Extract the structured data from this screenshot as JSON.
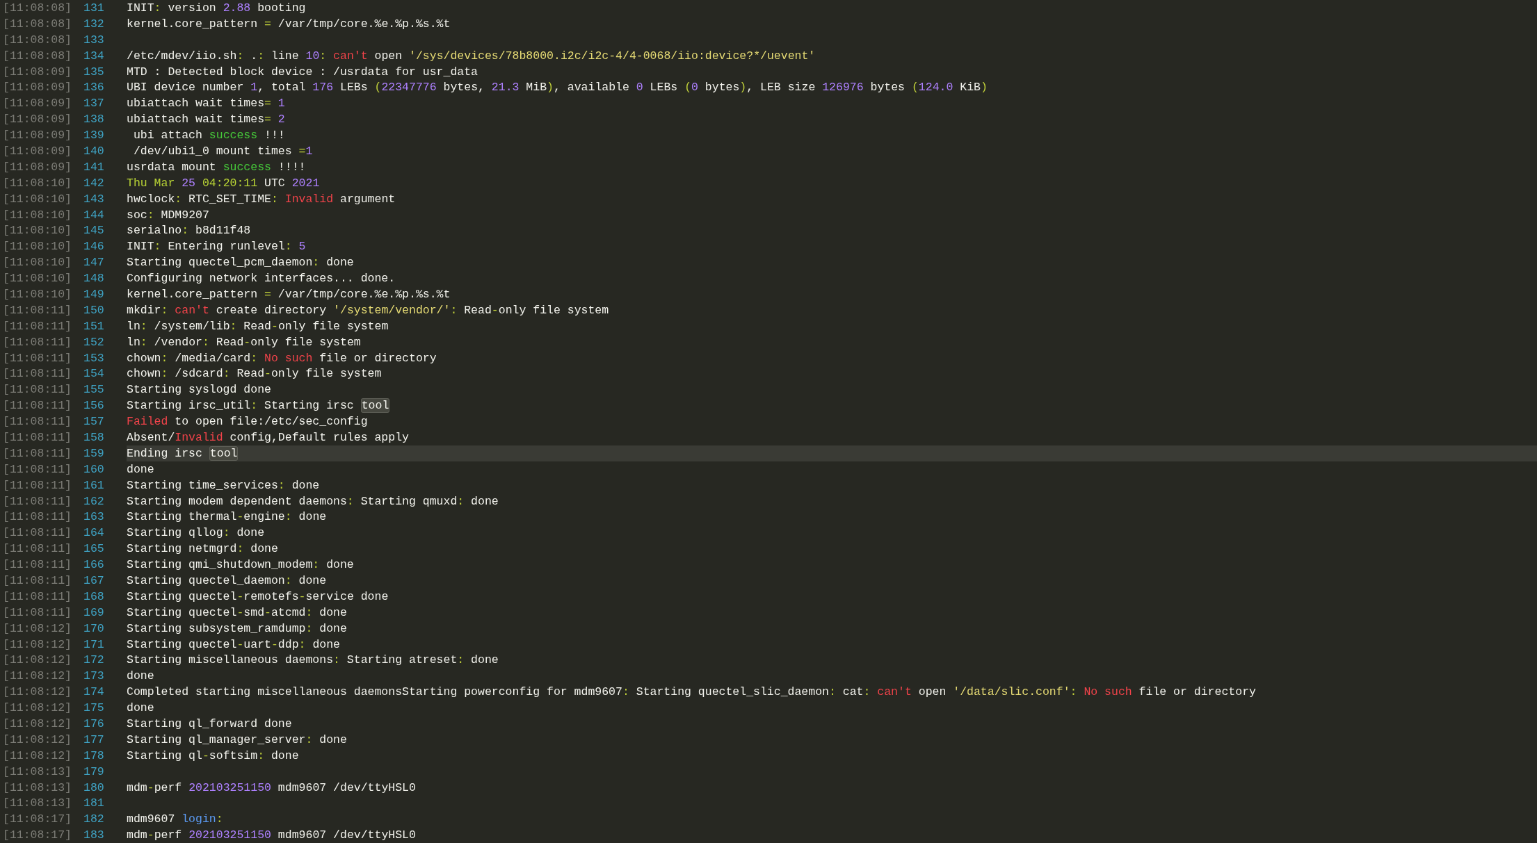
{
  "lines": [
    {
      "time": "[11:08:08]",
      "number": "131",
      "current": false,
      "segments": [
        {
          "text": "INIT",
          "kind": "text"
        },
        {
          "text": ":",
          "kind": "punct"
        },
        {
          "text": " version ",
          "kind": "text"
        },
        {
          "text": "2.88",
          "kind": "number"
        },
        {
          "text": " booting",
          "kind": "text"
        }
      ]
    },
    {
      "time": "[11:08:08]",
      "number": "132",
      "current": false,
      "segments": [
        {
          "text": "kernel.core_pattern ",
          "kind": "text"
        },
        {
          "text": "=",
          "kind": "punct"
        },
        {
          "text": " /var/tmp/core.%e.%p.%s.%t",
          "kind": "text"
        }
      ]
    },
    {
      "time": "[11:08:08]",
      "number": "133",
      "current": false
    },
    {
      "time": "[11:08:08]",
      "number": "134",
      "current": false,
      "segments": [
        {
          "text": "/etc/mdev/iio.sh",
          "kind": "text"
        },
        {
          "text": ":",
          "kind": "punct"
        },
        {
          "text": " .",
          "kind": "text"
        },
        {
          "text": ":",
          "kind": "punct"
        },
        {
          "text": " line ",
          "kind": "text"
        },
        {
          "text": "10",
          "kind": "number"
        },
        {
          "text": ": ",
          "kind": "punct"
        },
        {
          "text": "can't",
          "kind": "error"
        },
        {
          "text": " open ",
          "kind": "text"
        },
        {
          "text": "'/sys/devices/78b8000.i2c/i2c-4/4-0068/iio:device?*/uevent'",
          "kind": "string"
        }
      ]
    },
    {
      "time": "[11:08:09]",
      "number": "135",
      "current": false,
      "segments": [
        {
          "text": "MTD : Detected block device : /usrdata for usr_data",
          "kind": "text"
        }
      ]
    },
    {
      "time": "[11:08:09]",
      "number": "136",
      "current": false,
      "segments": [
        {
          "text": "UBI device number ",
          "kind": "text"
        },
        {
          "text": "1",
          "kind": "number"
        },
        {
          "text": ", total ",
          "kind": "text"
        },
        {
          "text": "176",
          "kind": "number"
        },
        {
          "text": " LEBs ",
          "kind": "text"
        },
        {
          "text": "(",
          "kind": "punct"
        },
        {
          "text": "22347776",
          "kind": "number"
        },
        {
          "text": " bytes, ",
          "kind": "text"
        },
        {
          "text": "21.3",
          "kind": "number"
        },
        {
          "text": " MiB",
          "kind": "text"
        },
        {
          "text": ")",
          "kind": "punct"
        },
        {
          "text": ", available ",
          "kind": "text"
        },
        {
          "text": "0",
          "kind": "number"
        },
        {
          "text": " LEBs ",
          "kind": "text"
        },
        {
          "text": "(",
          "kind": "punct"
        },
        {
          "text": "0",
          "kind": "number"
        },
        {
          "text": " bytes",
          "kind": "text"
        },
        {
          "text": ")",
          "kind": "punct"
        },
        {
          "text": ", LEB size ",
          "kind": "text"
        },
        {
          "text": "126976",
          "kind": "number"
        },
        {
          "text": " bytes ",
          "kind": "text"
        },
        {
          "text": "(",
          "kind": "punct"
        },
        {
          "text": "124.0",
          "kind": "number"
        },
        {
          "text": " KiB",
          "kind": "text"
        },
        {
          "text": ")",
          "kind": "punct"
        }
      ]
    },
    {
      "time": "[11:08:09]",
      "number": "137",
      "current": false,
      "segments": [
        {
          "text": "ubiattach wait times",
          "kind": "text"
        },
        {
          "text": "= ",
          "kind": "punct"
        },
        {
          "text": "1",
          "kind": "number"
        }
      ]
    },
    {
      "time": "[11:08:09]",
      "number": "138",
      "current": false,
      "segments": [
        {
          "text": "ubiattach wait times",
          "kind": "text"
        },
        {
          "text": "= ",
          "kind": "punct"
        },
        {
          "text": "2",
          "kind": "number"
        }
      ]
    },
    {
      "time": "[11:08:09]",
      "number": "139",
      "current": false,
      "segments": [
        {
          "text": " ubi attach ",
          "kind": "text"
        },
        {
          "text": "success",
          "kind": "success"
        },
        {
          "text": " !!!",
          "kind": "text"
        }
      ]
    },
    {
      "time": "[11:08:09]",
      "number": "140",
      "current": false,
      "segments": [
        {
          "text": " /dev/ubi1_0 mount times ",
          "kind": "text"
        },
        {
          "text": "=",
          "kind": "punct"
        },
        {
          "text": "1",
          "kind": "number"
        }
      ]
    },
    {
      "time": "[11:08:09]",
      "number": "141",
      "current": false,
      "segments": [
        {
          "text": "usrdata mount ",
          "kind": "text"
        },
        {
          "text": "success",
          "kind": "success"
        },
        {
          "text": " !!!!",
          "kind": "text"
        }
      ]
    },
    {
      "time": "[11:08:10]",
      "number": "142",
      "current": false,
      "segments": [
        {
          "text": "Thu Mar ",
          "kind": "date"
        },
        {
          "text": "25",
          "kind": "number"
        },
        {
          "text": " 04:20:11",
          "kind": "date"
        },
        {
          "text": " UTC ",
          "kind": "text"
        },
        {
          "text": "2021",
          "kind": "number"
        }
      ]
    },
    {
      "time": "[11:08:10]",
      "number": "143",
      "current": false,
      "segments": [
        {
          "text": "hwclock",
          "kind": "text"
        },
        {
          "text": ":",
          "kind": "punct"
        },
        {
          "text": " RTC_SET_TIME",
          "kind": "text"
        },
        {
          "text": ": ",
          "kind": "punct"
        },
        {
          "text": "Invalid",
          "kind": "error"
        },
        {
          "text": " argument",
          "kind": "text"
        }
      ]
    },
    {
      "time": "[11:08:10]",
      "number": "144",
      "current": false,
      "segments": [
        {
          "text": "soc",
          "kind": "text"
        },
        {
          "text": ":",
          "kind": "punct"
        },
        {
          "text": " MDM9207",
          "kind": "text"
        }
      ]
    },
    {
      "time": "[11:08:10]",
      "number": "145",
      "current": false,
      "segments": [
        {
          "text": "serialno",
          "kind": "text"
        },
        {
          "text": ":",
          "kind": "punct"
        },
        {
          "text": " b8d11f48",
          "kind": "text"
        }
      ]
    },
    {
      "time": "[11:08:10]",
      "number": "146",
      "current": false,
      "segments": [
        {
          "text": "INIT",
          "kind": "text"
        },
        {
          "text": ":",
          "kind": "punct"
        },
        {
          "text": " Entering runlevel",
          "kind": "text"
        },
        {
          "text": ": ",
          "kind": "punct"
        },
        {
          "text": "5",
          "kind": "number"
        }
      ]
    },
    {
      "time": "[11:08:10]",
      "number": "147",
      "current": false,
      "segments": [
        {
          "text": "Starting quectel_pcm_daemon",
          "kind": "text"
        },
        {
          "text": ":",
          "kind": "punct"
        },
        {
          "text": " done",
          "kind": "text"
        }
      ]
    },
    {
      "time": "[11:08:10]",
      "number": "148",
      "current": false,
      "segments": [
        {
          "text": "Configuring network interfaces... done.",
          "kind": "text"
        }
      ]
    },
    {
      "time": "[11:08:10]",
      "number": "149",
      "current": false,
      "segments": [
        {
          "text": "kernel.core_pattern ",
          "kind": "text"
        },
        {
          "text": "=",
          "kind": "punct"
        },
        {
          "text": " /var/tmp/core.%e.%p.%s.%t",
          "kind": "text"
        }
      ]
    },
    {
      "time": "[11:08:11]",
      "number": "150",
      "current": false,
      "segments": [
        {
          "text": "mkdir",
          "kind": "text"
        },
        {
          "text": ": ",
          "kind": "punct"
        },
        {
          "text": "can't",
          "kind": "error"
        },
        {
          "text": " create directory ",
          "kind": "text"
        },
        {
          "text": "'/system/vendor/'",
          "kind": "string"
        },
        {
          "text": ":",
          "kind": "punct"
        },
        {
          "text": " Read",
          "kind": "text"
        },
        {
          "text": "-",
          "kind": "punct"
        },
        {
          "text": "only file system",
          "kind": "text"
        }
      ]
    },
    {
      "time": "[11:08:11]",
      "number": "151",
      "current": false,
      "segments": [
        {
          "text": "ln",
          "kind": "text"
        },
        {
          "text": ":",
          "kind": "punct"
        },
        {
          "text": " /system/lib",
          "kind": "text"
        },
        {
          "text": ":",
          "kind": "punct"
        },
        {
          "text": " Read",
          "kind": "text"
        },
        {
          "text": "-",
          "kind": "punct"
        },
        {
          "text": "only file system",
          "kind": "text"
        }
      ]
    },
    {
      "time": "[11:08:11]",
      "number": "152",
      "current": false,
      "segments": [
        {
          "text": "ln",
          "kind": "text"
        },
        {
          "text": ":",
          "kind": "punct"
        },
        {
          "text": " /vendor",
          "kind": "text"
        },
        {
          "text": ":",
          "kind": "punct"
        },
        {
          "text": " Read",
          "kind": "text"
        },
        {
          "text": "-",
          "kind": "punct"
        },
        {
          "text": "only file system",
          "kind": "text"
        }
      ]
    },
    {
      "time": "[11:08:11]",
      "number": "153",
      "current": false,
      "segments": [
        {
          "text": "chown",
          "kind": "text"
        },
        {
          "text": ":",
          "kind": "punct"
        },
        {
          "text": " /media/card",
          "kind": "text"
        },
        {
          "text": ": ",
          "kind": "punct"
        },
        {
          "text": "No such",
          "kind": "error"
        },
        {
          "text": " file or directory",
          "kind": "text"
        }
      ]
    },
    {
      "time": "[11:08:11]",
      "number": "154",
      "current": false,
      "segments": [
        {
          "text": "chown",
          "kind": "text"
        },
        {
          "text": ":",
          "kind": "punct"
        },
        {
          "text": " /sdcard",
          "kind": "text"
        },
        {
          "text": ":",
          "kind": "punct"
        },
        {
          "text": " Read",
          "kind": "text"
        },
        {
          "text": "-",
          "kind": "punct"
        },
        {
          "text": "only file system",
          "kind": "text"
        }
      ]
    },
    {
      "time": "[11:08:11]",
      "number": "155",
      "current": false,
      "segments": [
        {
          "text": "Starting syslogd done",
          "kind": "text"
        }
      ]
    },
    {
      "time": "[11:08:11]",
      "number": "156",
      "current": false,
      "segments": [
        {
          "text": "Starting irsc_util",
          "kind": "text"
        },
        {
          "text": ":",
          "kind": "punct"
        },
        {
          "text": " Starting irsc ",
          "kind": "text"
        },
        {
          "text": "tool",
          "kind": "match"
        }
      ]
    },
    {
      "time": "[11:08:11]",
      "number": "157",
      "current": false,
      "segments": [
        {
          "text": "Failed",
          "kind": "error"
        },
        {
          "text": " to open file:/etc/sec_config",
          "kind": "text"
        }
      ]
    },
    {
      "time": "[11:08:11]",
      "number": "158",
      "current": false,
      "segments": [
        {
          "text": "Absent/",
          "kind": "text"
        },
        {
          "text": "Invalid",
          "kind": "error"
        },
        {
          "text": " config,Default rules apply",
          "kind": "text"
        }
      ]
    },
    {
      "time": "[11:08:11]",
      "number": "159",
      "current": true,
      "segments": [
        {
          "text": "Ending irsc ",
          "kind": "text"
        },
        {
          "text": "tool",
          "kind": "match"
        }
      ]
    },
    {
      "time": "[11:08:11]",
      "number": "160",
      "current": false,
      "segments": [
        {
          "text": "done",
          "kind": "text"
        }
      ]
    },
    {
      "time": "[11:08:11]",
      "number": "161",
      "current": false,
      "segments": [
        {
          "text": "Starting time_services",
          "kind": "text"
        },
        {
          "text": ":",
          "kind": "punct"
        },
        {
          "text": " done",
          "kind": "text"
        }
      ]
    },
    {
      "time": "[11:08:11]",
      "number": "162",
      "current": false,
      "segments": [
        {
          "text": "Starting modem dependent daemons",
          "kind": "text"
        },
        {
          "text": ":",
          "kind": "punct"
        },
        {
          "text": " Starting qmuxd",
          "kind": "text"
        },
        {
          "text": ":",
          "kind": "punct"
        },
        {
          "text": " done",
          "kind": "text"
        }
      ]
    },
    {
      "time": "[11:08:11]",
      "number": "163",
      "current": false,
      "segments": [
        {
          "text": "Starting thermal",
          "kind": "text"
        },
        {
          "text": "-",
          "kind": "punct"
        },
        {
          "text": "engine",
          "kind": "text"
        },
        {
          "text": ":",
          "kind": "punct"
        },
        {
          "text": " done",
          "kind": "text"
        }
      ]
    },
    {
      "time": "[11:08:11]",
      "number": "164",
      "current": false,
      "segments": [
        {
          "text": "Starting qllog",
          "kind": "text"
        },
        {
          "text": ":",
          "kind": "punct"
        },
        {
          "text": " done",
          "kind": "text"
        }
      ]
    },
    {
      "time": "[11:08:11]",
      "number": "165",
      "current": false,
      "segments": [
        {
          "text": "Starting netmgrd",
          "kind": "text"
        },
        {
          "text": ":",
          "kind": "punct"
        },
        {
          "text": " done",
          "kind": "text"
        }
      ]
    },
    {
      "time": "[11:08:11]",
      "number": "166",
      "current": false,
      "segments": [
        {
          "text": "Starting qmi_shutdown_modem",
          "kind": "text"
        },
        {
          "text": ":",
          "kind": "punct"
        },
        {
          "text": " done",
          "kind": "text"
        }
      ]
    },
    {
      "time": "[11:08:11]",
      "number": "167",
      "current": false,
      "segments": [
        {
          "text": "Starting quectel_daemon",
          "kind": "text"
        },
        {
          "text": ":",
          "kind": "punct"
        },
        {
          "text": " done",
          "kind": "text"
        }
      ]
    },
    {
      "time": "[11:08:11]",
      "number": "168",
      "current": false,
      "segments": [
        {
          "text": "Starting quectel",
          "kind": "text"
        },
        {
          "text": "-",
          "kind": "punct"
        },
        {
          "text": "remotefs",
          "kind": "text"
        },
        {
          "text": "-",
          "kind": "punct"
        },
        {
          "text": "service done",
          "kind": "text"
        }
      ]
    },
    {
      "time": "[11:08:11]",
      "number": "169",
      "current": false,
      "segments": [
        {
          "text": "Starting quectel",
          "kind": "text"
        },
        {
          "text": "-",
          "kind": "punct"
        },
        {
          "text": "smd",
          "kind": "text"
        },
        {
          "text": "-",
          "kind": "punct"
        },
        {
          "text": "atcmd",
          "kind": "text"
        },
        {
          "text": ":",
          "kind": "punct"
        },
        {
          "text": " done",
          "kind": "text"
        }
      ]
    },
    {
      "time": "[11:08:12]",
      "number": "170",
      "current": false,
      "segments": [
        {
          "text": "Starting subsystem_ramdump",
          "kind": "text"
        },
        {
          "text": ":",
          "kind": "punct"
        },
        {
          "text": " done",
          "kind": "text"
        }
      ]
    },
    {
      "time": "[11:08:12]",
      "number": "171",
      "current": false,
      "segments": [
        {
          "text": "Starting quectel",
          "kind": "text"
        },
        {
          "text": "-",
          "kind": "punct"
        },
        {
          "text": "uart",
          "kind": "text"
        },
        {
          "text": "-",
          "kind": "punct"
        },
        {
          "text": "ddp",
          "kind": "text"
        },
        {
          "text": ":",
          "kind": "punct"
        },
        {
          "text": " done",
          "kind": "text"
        }
      ]
    },
    {
      "time": "[11:08:12]",
      "number": "172",
      "current": false,
      "segments": [
        {
          "text": "Starting miscellaneous daemons",
          "kind": "text"
        },
        {
          "text": ":",
          "kind": "punct"
        },
        {
          "text": " Starting atreset",
          "kind": "text"
        },
        {
          "text": ":",
          "kind": "punct"
        },
        {
          "text": " done",
          "kind": "text"
        }
      ]
    },
    {
      "time": "[11:08:12]",
      "number": "173",
      "current": false,
      "segments": [
        {
          "text": "done",
          "kind": "text"
        }
      ]
    },
    {
      "time": "[11:08:12]",
      "number": "174",
      "current": false,
      "segments": [
        {
          "text": "Completed starting miscellaneous daemonsStarting powerconfig for mdm9607",
          "kind": "text"
        },
        {
          "text": ":",
          "kind": "punct"
        },
        {
          "text": " Starting quectel_slic_daemon",
          "kind": "text"
        },
        {
          "text": ":",
          "kind": "punct"
        },
        {
          "text": " cat",
          "kind": "text"
        },
        {
          "text": ": ",
          "kind": "punct"
        },
        {
          "text": "can't",
          "kind": "error"
        },
        {
          "text": " open ",
          "kind": "text"
        },
        {
          "text": "'/data/slic.conf'",
          "kind": "string"
        },
        {
          "text": ": ",
          "kind": "punct"
        },
        {
          "text": "No such",
          "kind": "error"
        },
        {
          "text": " file or directory",
          "kind": "text"
        }
      ]
    },
    {
      "time": "[11:08:12]",
      "number": "175",
      "current": false,
      "segments": [
        {
          "text": "done",
          "kind": "text"
        }
      ]
    },
    {
      "time": "[11:08:12]",
      "number": "176",
      "current": false,
      "segments": [
        {
          "text": "Starting ql_forward done",
          "kind": "text"
        }
      ]
    },
    {
      "time": "[11:08:12]",
      "number": "177",
      "current": false,
      "segments": [
        {
          "text": "Starting ql_manager_server",
          "kind": "text"
        },
        {
          "text": ":",
          "kind": "punct"
        },
        {
          "text": " done",
          "kind": "text"
        }
      ]
    },
    {
      "time": "[11:08:12]",
      "number": "178",
      "current": false,
      "segments": [
        {
          "text": "Starting ql",
          "kind": "text"
        },
        {
          "text": "-",
          "kind": "punct"
        },
        {
          "text": "softsim",
          "kind": "text"
        },
        {
          "text": ":",
          "kind": "punct"
        },
        {
          "text": " done",
          "kind": "text"
        }
      ]
    },
    {
      "time": "[11:08:13]",
      "number": "179",
      "current": false
    },
    {
      "time": "[11:08:13]",
      "number": "180",
      "current": false,
      "segments": [
        {
          "text": "mdm",
          "kind": "text"
        },
        {
          "text": "-",
          "kind": "punct"
        },
        {
          "text": "perf ",
          "kind": "text"
        },
        {
          "text": "202103251150",
          "kind": "number"
        },
        {
          "text": " mdm9607 /dev/ttyHSL0",
          "kind": "text"
        }
      ]
    },
    {
      "time": "[11:08:13]",
      "number": "181",
      "current": false
    },
    {
      "time": "[11:08:17]",
      "number": "182",
      "current": false,
      "segments": [
        {
          "text": "mdm9607 ",
          "kind": "text"
        },
        {
          "text": "login",
          "kind": "keyword"
        },
        {
          "text": ":",
          "kind": "punct"
        }
      ]
    },
    {
      "time": "[11:08:17]",
      "number": "183",
      "current": false,
      "segments": [
        {
          "text": "mdm",
          "kind": "text"
        },
        {
          "text": "-",
          "kind": "punct"
        },
        {
          "text": "perf ",
          "kind": "text"
        },
        {
          "text": "202103251150",
          "kind": "number"
        },
        {
          "text": " mdm9607 /dev/ttyHSL0",
          "kind": "text"
        }
      ]
    }
  ]
}
